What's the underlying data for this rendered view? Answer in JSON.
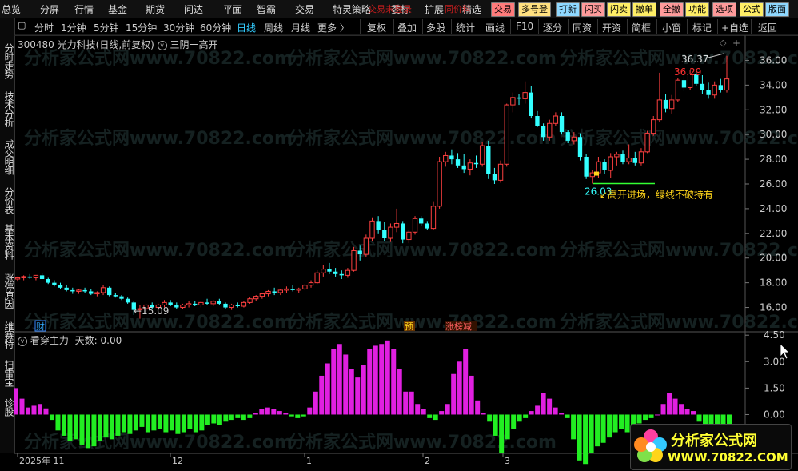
{
  "menu": {
    "items": [
      {
        "label": "总览"
      },
      {
        "label": "分屏"
      },
      {
        "label": "行情"
      },
      {
        "label": "基金"
      },
      {
        "label": "期货"
      },
      {
        "label": "问达"
      },
      {
        "label": "平面"
      },
      {
        "label": "智霸"
      },
      {
        "label": "交易"
      },
      {
        "label": "特灵策略"
      },
      {
        "label": "委标"
      },
      {
        "label": "扩展"
      },
      {
        "label": "精选"
      }
    ],
    "hot_text_1": "交易未登录",
    "hot_text_2": "同价科",
    "tools": [
      {
        "label": "交易",
        "color": "#ff7b7b"
      },
      {
        "label": "多号登",
        "color": "#ffe080"
      },
      {
        "label": "打新",
        "color": "#8fd8ff"
      },
      {
        "label": "闪买",
        "color": "#ff9b9b"
      },
      {
        "label": "闪卖",
        "color": "#ffee66"
      },
      {
        "label": "撤单",
        "color": "#ffee66"
      },
      {
        "label": "全撤",
        "color": "#ff9b9b"
      },
      {
        "label": "功能",
        "color": "#ffee66"
      },
      {
        "label": "选项",
        "color": "#ff9b9b"
      },
      {
        "label": "公式",
        "color": "#ffee66"
      },
      {
        "label": "版面",
        "color": "#8fd8ff"
      }
    ]
  },
  "left_tabs": [
    "分时走势",
    "技术分析",
    "成交明细",
    "分价表",
    "基本资料",
    "涨停原因",
    "维赛特",
    "扫雷宝",
    "诊股"
  ],
  "periods": [
    "分时",
    "1分钟",
    "5分钟",
    "15分钟",
    "30分钟",
    "60分钟",
    "日线",
    "周线",
    "月线",
    "更多 〉"
  ],
  "active_period": "日线",
  "tools_row": [
    "复权",
    "叠加",
    "多股",
    "统计",
    "画线",
    "F10",
    "逐分",
    "同资",
    "开资",
    "简框",
    "小窗",
    "标记",
    "+自选",
    "返回"
  ],
  "stock": {
    "code": "300480",
    "name": "光力科技",
    "mode": "(日线,前复权)",
    "formula": "三阴一高开"
  },
  "main_chart": {
    "y_ticks": [
      "36.00",
      "34.00",
      "32.00",
      "30.00",
      "28.00",
      "26.00",
      "24.00",
      "22.00",
      "20.00",
      "18.00",
      "16.00"
    ],
    "annotation_high": "36.37",
    "annotation_mid": "36.29",
    "annotation_low": "15.09",
    "annotation_entry_price": "26.03",
    "annotation_text": "高开进场，绿线不破持有",
    "markers": {
      "cai": "财",
      "yu": "预",
      "zt": "涨榜减"
    }
  },
  "indicator": {
    "name": "看穿主力",
    "days_label": "天数:",
    "days_value": "0.00",
    "y_ticks": [
      "4.50",
      "3.00",
      "1.50",
      "0.00"
    ]
  },
  "x_axis": [
    "2025年 11",
    "12",
    "1",
    "2",
    "3"
  ],
  "watermark": "分析家公式网www.70822.com",
  "logo": {
    "title": "分析家公式网",
    "url": "WWW.70822.COM"
  },
  "chart_data": [
    {
      "type": "candlestick",
      "title": "300480 光力科技(日线,前复权)",
      "ylim": [
        15.0,
        37.0
      ],
      "x_tick_labels": [
        "2025年 11",
        "12",
        "1",
        "2",
        "3"
      ],
      "ohlc": [
        [
          18.3,
          18.5,
          18.1,
          18.4
        ],
        [
          18.4,
          18.6,
          18.2,
          18.5
        ],
        [
          18.5,
          18.7,
          18.3,
          18.4
        ],
        [
          18.4,
          18.6,
          18.2,
          18.6
        ],
        [
          18.6,
          18.8,
          18.3,
          18.3
        ],
        [
          18.3,
          18.4,
          17.9,
          18.0
        ],
        [
          18.0,
          18.2,
          17.7,
          17.8
        ],
        [
          17.8,
          18.0,
          17.5,
          17.6
        ],
        [
          17.6,
          17.8,
          17.3,
          17.4
        ],
        [
          17.4,
          17.6,
          17.1,
          17.3
        ],
        [
          17.3,
          17.5,
          17.1,
          17.4
        ],
        [
          17.4,
          17.6,
          17.2,
          17.3
        ],
        [
          17.3,
          17.5,
          17.0,
          17.1
        ],
        [
          17.1,
          17.3,
          16.9,
          17.2
        ],
        [
          17.2,
          17.8,
          17.0,
          17.6
        ],
        [
          17.6,
          17.7,
          16.9,
          17.0
        ],
        [
          17.0,
          17.2,
          16.8,
          16.9
        ],
        [
          16.9,
          17.0,
          16.6,
          16.7
        ],
        [
          16.7,
          16.8,
          16.3,
          16.4
        ],
        [
          16.4,
          16.5,
          15.4,
          15.8
        ],
        [
          15.8,
          16.2,
          15.09,
          15.9
        ],
        [
          15.9,
          16.3,
          15.7,
          16.2
        ],
        [
          16.2,
          16.4,
          15.9,
          16.0
        ],
        [
          16.0,
          16.3,
          15.8,
          16.2
        ],
        [
          16.2,
          16.6,
          16.0,
          16.4
        ],
        [
          16.4,
          16.6,
          16.1,
          16.2
        ],
        [
          16.2,
          16.4,
          15.9,
          16.0
        ],
        [
          16.0,
          16.3,
          15.9,
          16.2
        ],
        [
          16.2,
          16.5,
          16.0,
          16.3
        ],
        [
          16.3,
          16.5,
          16.1,
          16.2
        ],
        [
          16.2,
          16.5,
          16.0,
          16.4
        ],
        [
          16.4,
          16.7,
          16.2,
          16.3
        ],
        [
          16.3,
          16.6,
          16.1,
          16.5
        ],
        [
          16.5,
          16.7,
          16.2,
          16.3
        ],
        [
          16.3,
          16.4,
          15.9,
          16.0
        ],
        [
          16.0,
          16.3,
          15.8,
          16.2
        ],
        [
          16.2,
          16.4,
          16.0,
          16.1
        ],
        [
          16.1,
          16.5,
          16.0,
          16.4
        ],
        [
          16.4,
          16.8,
          16.3,
          16.7
        ],
        [
          16.7,
          17.0,
          16.5,
          16.9
        ],
        [
          16.9,
          17.2,
          16.7,
          17.1
        ],
        [
          17.1,
          17.4,
          16.9,
          17.3
        ],
        [
          17.3,
          17.6,
          17.0,
          17.2
        ],
        [
          17.2,
          17.5,
          17.0,
          17.4
        ],
        [
          17.4,
          17.7,
          17.2,
          17.5
        ],
        [
          17.5,
          17.8,
          17.3,
          17.4
        ],
        [
          17.4,
          17.6,
          17.2,
          17.5
        ],
        [
          17.5,
          17.9,
          17.4,
          17.8
        ],
        [
          17.8,
          18.2,
          17.6,
          18.0
        ],
        [
          18.0,
          19.0,
          17.9,
          18.8
        ],
        [
          18.8,
          19.4,
          18.5,
          19.1
        ],
        [
          19.1,
          19.6,
          18.7,
          18.9
        ],
        [
          18.9,
          19.2,
          18.5,
          18.7
        ],
        [
          18.7,
          19.0,
          18.3,
          18.6
        ],
        [
          18.6,
          19.2,
          18.4,
          19.0
        ],
        [
          19.0,
          20.9,
          18.9,
          20.6
        ],
        [
          20.6,
          21.0,
          19.8,
          20.3
        ],
        [
          20.3,
          21.9,
          20.1,
          21.6
        ],
        [
          21.6,
          23.3,
          21.4,
          23.0
        ],
        [
          23.0,
          23.4,
          22.0,
          22.3
        ],
        [
          22.3,
          22.9,
          21.4,
          21.6
        ],
        [
          21.6,
          22.8,
          21.3,
          22.5
        ],
        [
          22.5,
          24.0,
          22.1,
          22.8
        ],
        [
          22.8,
          23.0,
          21.2,
          21.5
        ],
        [
          21.5,
          22.3,
          21.2,
          22.1
        ],
        [
          22.1,
          23.4,
          21.9,
          23.2
        ],
        [
          23.2,
          23.4,
          22.6,
          22.8
        ],
        [
          22.8,
          23.0,
          22.3,
          22.4
        ],
        [
          22.4,
          24.6,
          22.3,
          24.2
        ],
        [
          24.2,
          28.2,
          24.0,
          27.8
        ],
        [
          27.8,
          28.6,
          27.4,
          28.3
        ],
        [
          28.3,
          28.8,
          27.6,
          28.0
        ],
        [
          28.0,
          28.5,
          27.3,
          27.5
        ],
        [
          27.5,
          28.4,
          26.9,
          27.2
        ],
        [
          27.2,
          28.0,
          26.7,
          27.7
        ],
        [
          27.7,
          28.3,
          27.3,
          27.6
        ],
        [
          27.6,
          29.4,
          27.4,
          29.1
        ],
        [
          29.1,
          29.5,
          26.4,
          26.8
        ],
        [
          26.8,
          27.3,
          26.0,
          26.3
        ],
        [
          26.3,
          27.9,
          26.1,
          27.6
        ],
        [
          27.6,
          32.5,
          27.4,
          32.4
        ],
        [
          32.4,
          33.4,
          31.8,
          33.0
        ],
        [
          33.0,
          33.3,
          32.4,
          32.9
        ],
        [
          32.9,
          34.3,
          32.5,
          33.4
        ],
        [
          33.4,
          33.9,
          31.3,
          31.5
        ],
        [
          31.5,
          31.9,
          30.6,
          30.7
        ],
        [
          30.7,
          30.9,
          29.5,
          29.8
        ],
        [
          29.8,
          31.2,
          29.5,
          30.9
        ],
        [
          30.9,
          31.8,
          30.7,
          31.5
        ],
        [
          31.5,
          31.8,
          30.0,
          30.2
        ],
        [
          30.2,
          30.4,
          29.3,
          29.5
        ],
        [
          29.5,
          30.2,
          29.2,
          29.8
        ],
        [
          29.8,
          30.1,
          27.9,
          28.2
        ],
        [
          28.2,
          28.4,
          26.4,
          26.6
        ],
        [
          26.6,
          27.1,
          26.03,
          26.9
        ],
        [
          26.9,
          28.2,
          26.5,
          27.8
        ],
        [
          27.8,
          28.0,
          26.8,
          27.1
        ],
        [
          27.1,
          28.5,
          26.5,
          28.2
        ],
        [
          28.2,
          28.6,
          27.5,
          28.4
        ],
        [
          28.4,
          28.7,
          27.6,
          27.8
        ],
        [
          27.8,
          29.2,
          27.6,
          28.1
        ],
        [
          28.1,
          28.6,
          27.5,
          27.7
        ],
        [
          27.7,
          28.9,
          27.5,
          28.6
        ],
        [
          28.6,
          30.3,
          28.5,
          30.1
        ],
        [
          30.1,
          31.5,
          29.9,
          31.2
        ],
        [
          31.2,
          35.0,
          31.0,
          32.8
        ],
        [
          32.8,
          33.3,
          31.8,
          32.1
        ],
        [
          32.1,
          33.2,
          31.7,
          32.8
        ],
        [
          32.8,
          34.6,
          32.6,
          34.4
        ],
        [
          34.4,
          34.9,
          33.5,
          33.8
        ],
        [
          33.8,
          35.2,
          33.6,
          34.9
        ],
        [
          34.9,
          35.1,
          33.9,
          34.1
        ],
        [
          34.1,
          34.8,
          33.3,
          33.6
        ],
        [
          33.6,
          34.2,
          32.9,
          33.2
        ],
        [
          33.2,
          34.3,
          32.9,
          34.0
        ],
        [
          34.0,
          34.5,
          33.4,
          33.6
        ],
        [
          33.6,
          36.37,
          33.4,
          34.5
        ]
      ]
    },
    {
      "type": "bar",
      "title": "看穿主力",
      "ylim": [
        -2.2,
        4.6
      ],
      "values": [
        1.5,
        0.9,
        0.4,
        0.5,
        0.6,
        0.35,
        -0.3,
        -0.9,
        -1.2,
        -1.5,
        -1.4,
        -1.7,
        -1.9,
        -1.8,
        -1.5,
        -1.3,
        -1.4,
        -1.2,
        -1.0,
        -1.1,
        -0.9,
        -0.7,
        -1.0,
        -0.9,
        -0.8,
        -1.0,
        -0.9,
        -1.1,
        -1.0,
        -0.8,
        -1.0,
        -0.9,
        -0.6,
        -0.5,
        -0.6,
        -0.4,
        -0.3,
        -0.2,
        -0.3,
        -0.2,
        0.1,
        0.3,
        0.4,
        0.3,
        0.2,
        0.1,
        -0.1,
        -0.2,
        -0.1,
        0.4,
        1.3,
        2.2,
        2.9,
        3.7,
        4.0,
        3.4,
        2.6,
        2.1,
        2.8,
        3.7,
        3.9,
        4.0,
        4.2,
        3.7,
        2.6,
        1.3,
        1.3,
        0.6,
        0.3,
        -0.2,
        -0.3,
        0.2,
        0.6,
        2.3,
        3.0,
        3.7,
        2.2,
        0.8,
        0.1,
        -0.4,
        -1.2,
        -2.2,
        -1.4,
        -0.8,
        -0.4,
        -0.2,
        0.2,
        0.5,
        1.2,
        0.9,
        0.4,
        0.1,
        -0.2,
        -1.4,
        -2.6,
        -2.8,
        -2.2,
        -1.8,
        -1.6,
        -1.3,
        -1.0,
        -0.8,
        -1.0,
        -0.7,
        -0.5,
        -0.3,
        -0.2,
        0.0,
        0.6,
        1.2,
        0.9,
        0.6,
        0.3,
        0.2,
        -0.4,
        -0.6,
        -0.8,
        -0.8,
        -0.6,
        -0.7
      ]
    }
  ]
}
